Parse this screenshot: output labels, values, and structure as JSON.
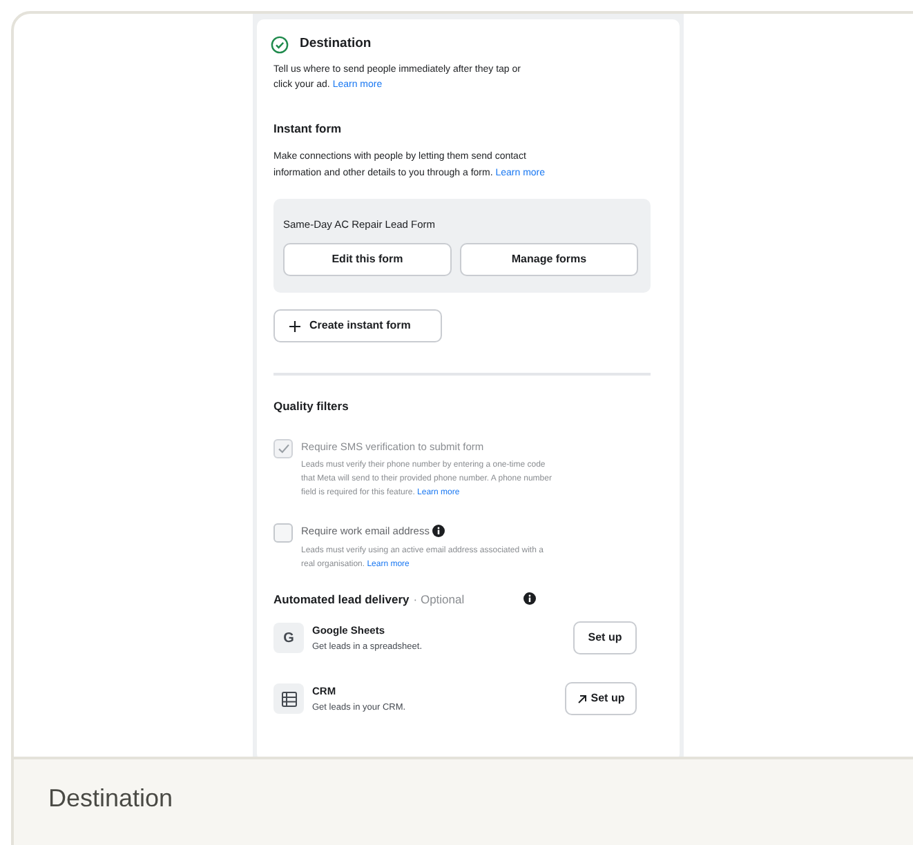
{
  "destination": {
    "title": "Destination",
    "checked": true,
    "description": "Tell us where to send people immediately after they tap or click your ad.",
    "link": "Learn more"
  },
  "instant_form": {
    "title": "Instant form",
    "description": "Make connections with people by letting them send contact information and other details to you through a form.",
    "link": "Learn more",
    "form_name": "Same-Day AC Repair Lead Form",
    "buttons": [
      "Edit this form",
      "Manage forms"
    ],
    "create_button": "Create instant form"
  },
  "quality_filters": {
    "title": "Quality filters",
    "items": [
      {
        "label": "Require SMS verification to submit form",
        "checked": true,
        "disabled": true,
        "info": false,
        "description": "Leads must verify their phone number by entering a one-time code that Meta will send to their provided phone number. A phone number field is required for this feature.",
        "link": "Learn more"
      },
      {
        "label": "Require work email address",
        "checked": false,
        "disabled": false,
        "info": true,
        "description": "Leads must verify using an active email address associated with a real organisation.",
        "link": "Learn more"
      }
    ]
  },
  "lead_delivery": {
    "title": "Automated lead delivery",
    "optional": "· Optional",
    "items": [
      {
        "kind": "letter",
        "letter": "G",
        "name": "Google Sheets",
        "description": "Get leads in a spreadsheet.",
        "button": "Set up",
        "external": false
      },
      {
        "kind": "table",
        "name": "CRM",
        "description": "Get leads in your CRM.",
        "button": "Set up",
        "external": true
      }
    ]
  },
  "caption": "Destination"
}
